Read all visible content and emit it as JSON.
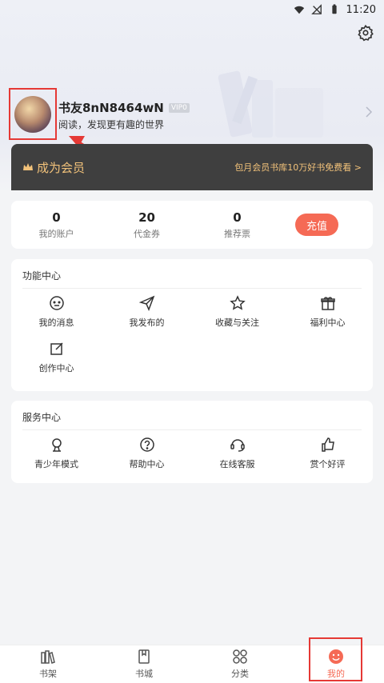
{
  "status_bar": {
    "time": "11:20"
  },
  "profile": {
    "username": "书友8nN8464wN",
    "vip_label": "VIP0",
    "slogan": "阅读，发现更有趣的世界"
  },
  "member_banner": {
    "title": "成为会员",
    "promo": "包月会员书库10万好书免费看 >"
  },
  "account": {
    "stats": [
      {
        "value": "0",
        "label": "我的账户"
      },
      {
        "value": "20",
        "label": "代金券"
      },
      {
        "value": "0",
        "label": "推荐票"
      }
    ],
    "recharge_label": "充值"
  },
  "function_center": {
    "title": "功能中心",
    "items": [
      {
        "label": "我的消息",
        "icon": "message-icon"
      },
      {
        "label": "我发布的",
        "icon": "send-icon"
      },
      {
        "label": "收藏与关注",
        "icon": "star-icon"
      },
      {
        "label": "福利中心",
        "icon": "gift-icon"
      },
      {
        "label": "创作中心",
        "icon": "edit-icon"
      }
    ]
  },
  "service_center": {
    "title": "服务中心",
    "items": [
      {
        "label": "青少年模式",
        "icon": "teen-icon"
      },
      {
        "label": "帮助中心",
        "icon": "help-icon"
      },
      {
        "label": "在线客服",
        "icon": "headset-icon"
      },
      {
        "label": "赏个好评",
        "icon": "thumbs-up-icon"
      }
    ]
  },
  "bottom_nav": {
    "items": [
      {
        "label": "书架",
        "icon": "bookshelf-icon"
      },
      {
        "label": "书城",
        "icon": "bookstore-icon"
      },
      {
        "label": "分类",
        "icon": "category-icon"
      },
      {
        "label": "我的",
        "icon": "profile-icon",
        "active": true
      }
    ]
  },
  "colors": {
    "accent": "#f56a55",
    "banner_bg": "#3f3f3f",
    "banner_text": "#f2c27a",
    "highlight_red": "#e53935"
  }
}
